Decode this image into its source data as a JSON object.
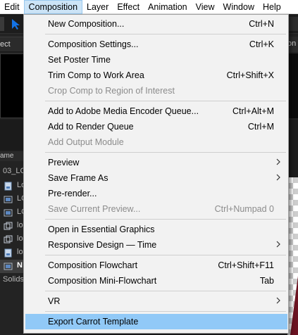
{
  "menubar": {
    "items": [
      "Edit",
      "Composition",
      "Layer",
      "Effect",
      "Animation",
      "View",
      "Window",
      "Help"
    ],
    "active_index": 1
  },
  "background": {
    "left_panel_tab": "ect",
    "right_panel_tab": "on",
    "project_header": "ame",
    "project_rows": [
      "03_LC",
      "Lo",
      "LC",
      "LC",
      "lo",
      "lo",
      "lo",
      "N",
      "Solids"
    ]
  },
  "menu": {
    "items": [
      {
        "label": "New Composition...",
        "shortcut": "Ctrl+N",
        "disabled": false
      },
      {
        "label": "Composition Settings...",
        "shortcut": "Ctrl+K",
        "disabled": false
      },
      {
        "label": "Set Poster Time",
        "shortcut": "",
        "disabled": false
      },
      {
        "label": "Trim Comp to Work Area",
        "shortcut": "Ctrl+Shift+X",
        "disabled": false
      },
      {
        "label": "Crop Comp to Region of Interest",
        "shortcut": "",
        "disabled": true
      },
      {
        "label": "Add to Adobe Media Encoder Queue...",
        "shortcut": "Ctrl+Alt+M",
        "disabled": false
      },
      {
        "label": "Add to Render Queue",
        "shortcut": "Ctrl+M",
        "disabled": false
      },
      {
        "label": "Add Output Module",
        "shortcut": "",
        "disabled": true
      },
      {
        "label": "Preview",
        "shortcut": "",
        "disabled": false,
        "submenu": true
      },
      {
        "label": "Save Frame As",
        "shortcut": "",
        "disabled": false,
        "submenu": true
      },
      {
        "label": "Pre-render...",
        "shortcut": "",
        "disabled": false
      },
      {
        "label": "Save Current Preview...",
        "shortcut": "Ctrl+Numpad 0",
        "disabled": true
      },
      {
        "label": "Open in Essential Graphics",
        "shortcut": "",
        "disabled": false
      },
      {
        "label": "Responsive Design — Time",
        "shortcut": "",
        "disabled": false,
        "submenu": true
      },
      {
        "label": "Composition Flowchart",
        "shortcut": "Ctrl+Shift+F11",
        "disabled": false
      },
      {
        "label": "Composition Mini-Flowchart",
        "shortcut": "Tab",
        "disabled": false
      },
      {
        "label": "VR",
        "shortcut": "",
        "disabled": false,
        "submenu": true
      },
      {
        "label": "Export Carrot Template",
        "shortcut": "",
        "disabled": false,
        "highlighted": true
      }
    ]
  },
  "colors": {
    "menu_highlight": "#91c9f7",
    "menubar_active": "#cce4f7",
    "disabled_text": "#8c8c8c",
    "app_background": "#232323",
    "tool_accent": "#1473e6"
  }
}
